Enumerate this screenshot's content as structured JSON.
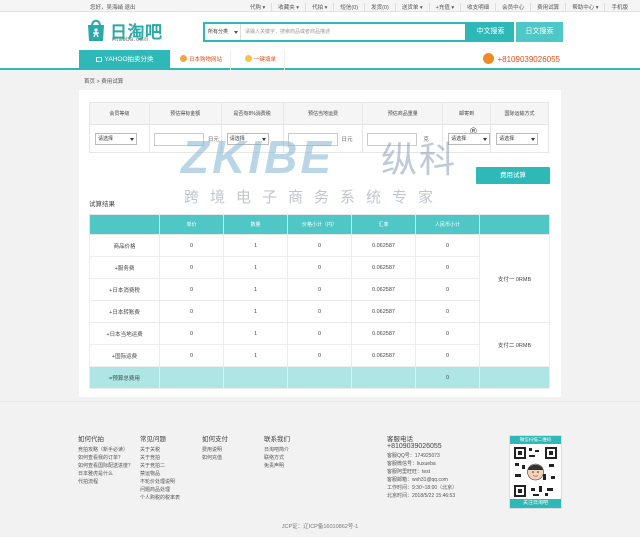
{
  "topbar": {
    "greeting": "您好，吴海峭 退出",
    "links": [
      "代购 ▾",
      "收藏夹 ▾",
      "代拍 ▾",
      "短信(0)",
      "发货(0)",
      "送货单 ▾",
      "+充值 ▾",
      "收支明细",
      "会员中心",
      "费用试算",
      "帮助中心 ▾",
      "手机版"
    ]
  },
  "header": {
    "logo_cn": "日淘吧",
    "logo_url": "ritaoba.com",
    "search_category": "所有分类",
    "search_placeholder": "请输入关键字，搜索商品或者商品描述",
    "btn_cn": "中文搜索",
    "btn_jp": "日文搜索"
  },
  "nav": {
    "yahoo": "YAHOO拍卖分类",
    "item1": "日本购物网站",
    "item2": "一键填单",
    "phone": "+8109039026055"
  },
  "breadcrumb": "首页 > 费用试算",
  "form": {
    "headers": [
      "会员等级",
      "预估得标金额",
      "是否有8%消费税",
      "预估当地运费",
      "预估商品重量",
      "邮寄到",
      "国际运输方式"
    ],
    "select_label": "请选择",
    "unit_yen": "日元",
    "unit_g": "克",
    "calc_button": "费用试算"
  },
  "watermark": {
    "brand": "ZKIBE",
    "brand_cn": "纵科",
    "tagline": "跨境电子商务系统专家"
  },
  "results": {
    "label": "试算结果",
    "headers": [
      "",
      "单价",
      "数量",
      "价格小计（円）",
      "汇率",
      "人民币小计",
      ""
    ],
    "rows": [
      [
        "商品价格",
        "0",
        "1",
        "0",
        "0.062587",
        "0"
      ],
      [
        "+服务费",
        "0",
        "1",
        "0",
        "0.062587",
        "0"
      ],
      [
        "+日本消费税",
        "0",
        "1",
        "0",
        "0.062587",
        "0"
      ],
      [
        "+日本转账费",
        "0",
        "1",
        "0",
        "0.062587",
        "0"
      ],
      [
        "+日本当地运费",
        "0",
        "1",
        "0",
        "0.062587",
        "0"
      ],
      [
        "+国际运费",
        "0",
        "1",
        "0",
        "0.062587",
        "0"
      ]
    ],
    "total_label": "=预算总费用",
    "total_value": "0",
    "pay1": "支付一 0RMB",
    "pay2": "支付二 0RMB"
  },
  "footer": {
    "cols": [
      {
        "title": "如何代拍",
        "items": [
          "竞拍攻略（新手必读）",
          "如何查看我的订单？",
          "如何查看国际配送进度？",
          "日本雅虎是什么",
          "代拍流程"
        ]
      },
      {
        "title": "常见问题",
        "items": [
          "关于关税",
          "关于竞拍",
          "关于竞拍二",
          "禁运物品",
          "不轮价处理说明",
          "问题商品处理",
          "个人购税的税率表"
        ]
      },
      {
        "title": "如何支付",
        "items": [
          "费用说明",
          "如何充值"
        ]
      },
      {
        "title": "联系我们",
        "items": [
          "日淘吧简介",
          "联络方式",
          "免责声明"
        ]
      }
    ],
    "service": {
      "title": "客服电话",
      "tel": "+8109039026055",
      "lines": [
        "客服QQ号：174925073",
        "客服微信号：liuxueba",
        "客服阿里旺旺：test",
        "客服邮箱：wxh31@qq.com",
        "工作时间：9:30~18:00（北京）",
        "北京时间：2018/5/22 15:46:53"
      ]
    },
    "qr_title": "微信扫描二维码",
    "qr_footer": "关注日淘吧",
    "icp": "JCP证：辽ICP备16010862号-1"
  },
  "colors": {
    "accent": "#2fb8b8",
    "accent_light": "#4fc7c7",
    "orange": "#e24c1a",
    "total_row": "#aee6e6"
  }
}
